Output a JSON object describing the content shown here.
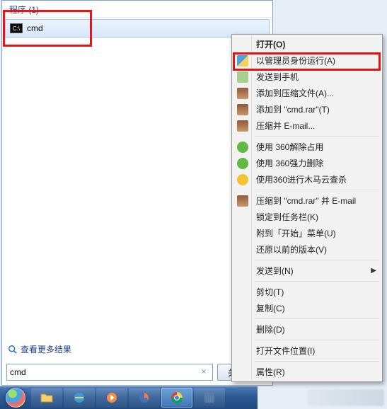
{
  "panel": {
    "section_header": "程序 (1)",
    "result_label": "cmd",
    "see_more": "查看更多结果",
    "search_value": "cmd",
    "clear_glyph": "×",
    "shutdown_label": "关机",
    "shutdown_more_glyph": "▸"
  },
  "context_menu": {
    "items": [
      {
        "label": "打开(O)",
        "bold": true
      },
      {
        "label": "以管理员身份运行(A)",
        "icon": "shield"
      },
      {
        "label": "发送到手机",
        "icon": "phone"
      },
      {
        "label": "添加到压缩文件(A)...",
        "icon": "rar"
      },
      {
        "label": "添加到 \"cmd.rar\"(T)",
        "icon": "rar"
      },
      {
        "label": "压缩并 E-mail...",
        "icon": "rar"
      },
      {
        "sep": true
      },
      {
        "label": "使用 360解除占用",
        "icon": "g360"
      },
      {
        "label": "使用 360强力删除",
        "icon": "g360"
      },
      {
        "label": "使用360进行木马云查杀",
        "icon": "y360"
      },
      {
        "sep": true
      },
      {
        "label": "压缩到 \"cmd.rar\" 并 E-mail",
        "icon": "rar"
      },
      {
        "label": "锁定到任务栏(K)"
      },
      {
        "label": "附到「开始」菜单(U)"
      },
      {
        "label": "还原以前的版本(V)"
      },
      {
        "sep": true
      },
      {
        "label": "发送到(N)",
        "submenu": true
      },
      {
        "sep": true
      },
      {
        "label": "剪切(T)"
      },
      {
        "label": "复制(C)"
      },
      {
        "sep": true
      },
      {
        "label": "删除(D)"
      },
      {
        "sep": true
      },
      {
        "label": "打开文件位置(I)"
      },
      {
        "sep": true
      },
      {
        "label": "属性(R)"
      }
    ],
    "submenu_glyph": "▶"
  },
  "taskbar": {
    "items": [
      "start",
      "explorer",
      "ie",
      "wmp",
      "firefox",
      "chrome",
      "app"
    ]
  }
}
